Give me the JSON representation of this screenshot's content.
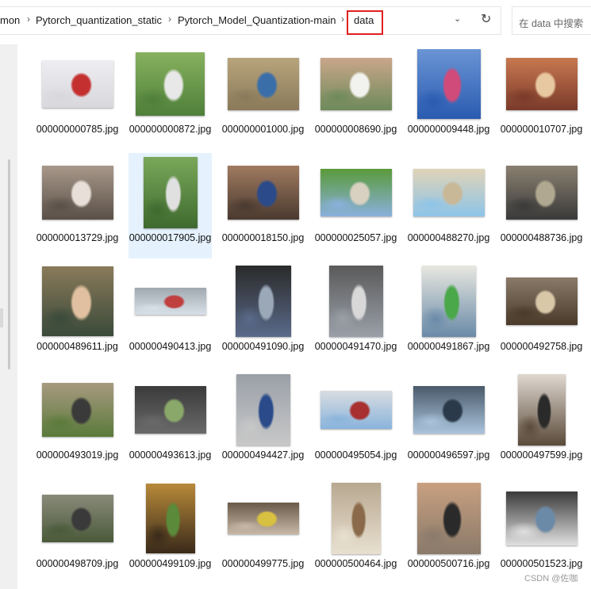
{
  "breadcrumb": {
    "items": [
      "mon",
      "Pytorch_quantization_static",
      "Pytorch_Model_Quantization-main",
      "data"
    ]
  },
  "search": {
    "placeholder": "在 data 中搜索"
  },
  "icons": {
    "dropdown": "chevron-down-icon",
    "refresh": "refresh-icon"
  },
  "files": [
    "000000000785.jpg",
    "000000000872.jpg",
    "000000001000.jpg",
    "000000008690.jpg",
    "000000009448.jpg",
    "000000010707.jpg",
    "000000013729.jpg",
    "000000017905.jpg",
    "000000018150.jpg",
    "000000025057.jpg",
    "000000488270.jpg",
    "000000488736.jpg",
    "000000489611.jpg",
    "000000490413.jpg",
    "000000491090.jpg",
    "000000491470.jpg",
    "000000491867.jpg",
    "000000492758.jpg",
    "000000493019.jpg",
    "000000493613.jpg",
    "000000494427.jpg",
    "000000495054.jpg",
    "000000496597.jpg",
    "000000497599.jpg",
    "000000498709.jpg",
    "000000499109.jpg",
    "000000499775.jpg",
    "000000500464.jpg",
    "000000500716.jpg",
    "000000501523.jpg"
  ],
  "selected_file": "000000017905.jpg",
  "watermark": "CSDN @佐咖"
}
